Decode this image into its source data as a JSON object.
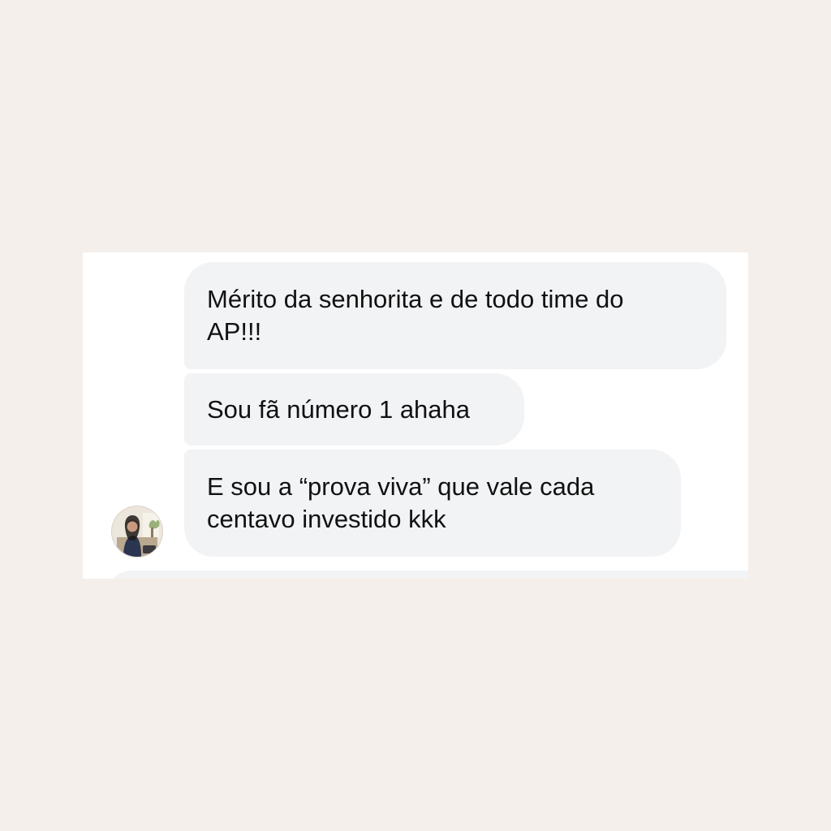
{
  "conversation": {
    "messages": [
      {
        "text": "Mérito da senhorita e de todo time do\nAP!!!"
      },
      {
        "text": "Sou fã número 1 ahaha"
      },
      {
        "text": "E sou a “prova viva” que vale cada\ncentavo investido kkk"
      }
    ],
    "avatar_icon": "profile-photo-icon"
  },
  "colors": {
    "page_background": "#f4efea",
    "card_background": "#ffffff",
    "bubble_background": "#f2f3f5",
    "text": "#111111"
  }
}
